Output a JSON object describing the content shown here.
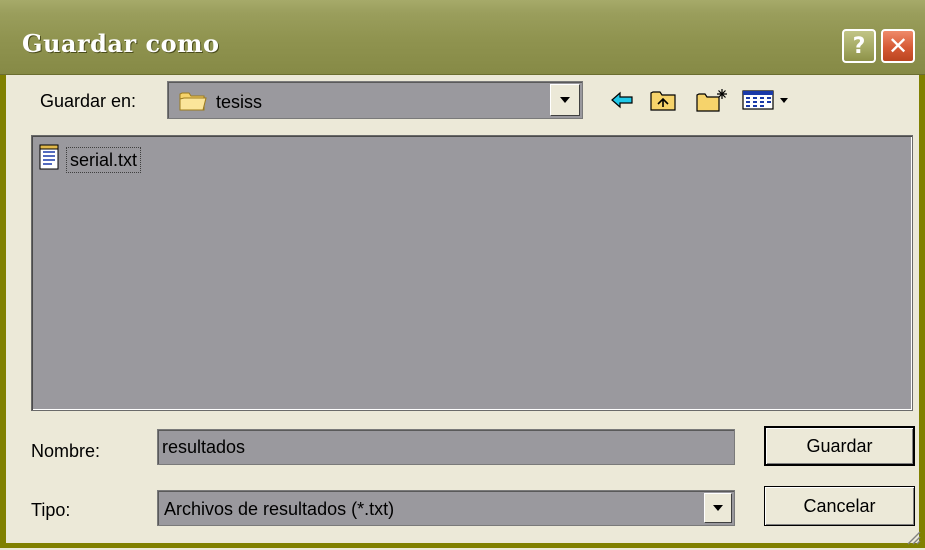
{
  "window": {
    "title": "Guardar como",
    "help_glyph": "?",
    "close_glyph": "✕"
  },
  "toolbar": {
    "save_in_label": "Guardar en:",
    "save_in_value": "tesiss",
    "icons": [
      "back-arrow-icon",
      "up-folder-icon",
      "new-folder-icon",
      "view-menu-icon"
    ]
  },
  "files": [
    {
      "name": "serial.txt",
      "icon": "text-file-icon"
    }
  ],
  "form": {
    "name_label": "Nombre:",
    "name_value": "resultados",
    "type_label": "Tipo:",
    "type_value": "Archivos de resultados (*.txt)"
  },
  "buttons": {
    "save": "Guardar",
    "cancel": "Cancelar"
  },
  "colors": {
    "titlebar": "#8f934f",
    "frame": "#808000",
    "field_bg": "#9a999e",
    "dialog_bg": "#ece9d8"
  }
}
